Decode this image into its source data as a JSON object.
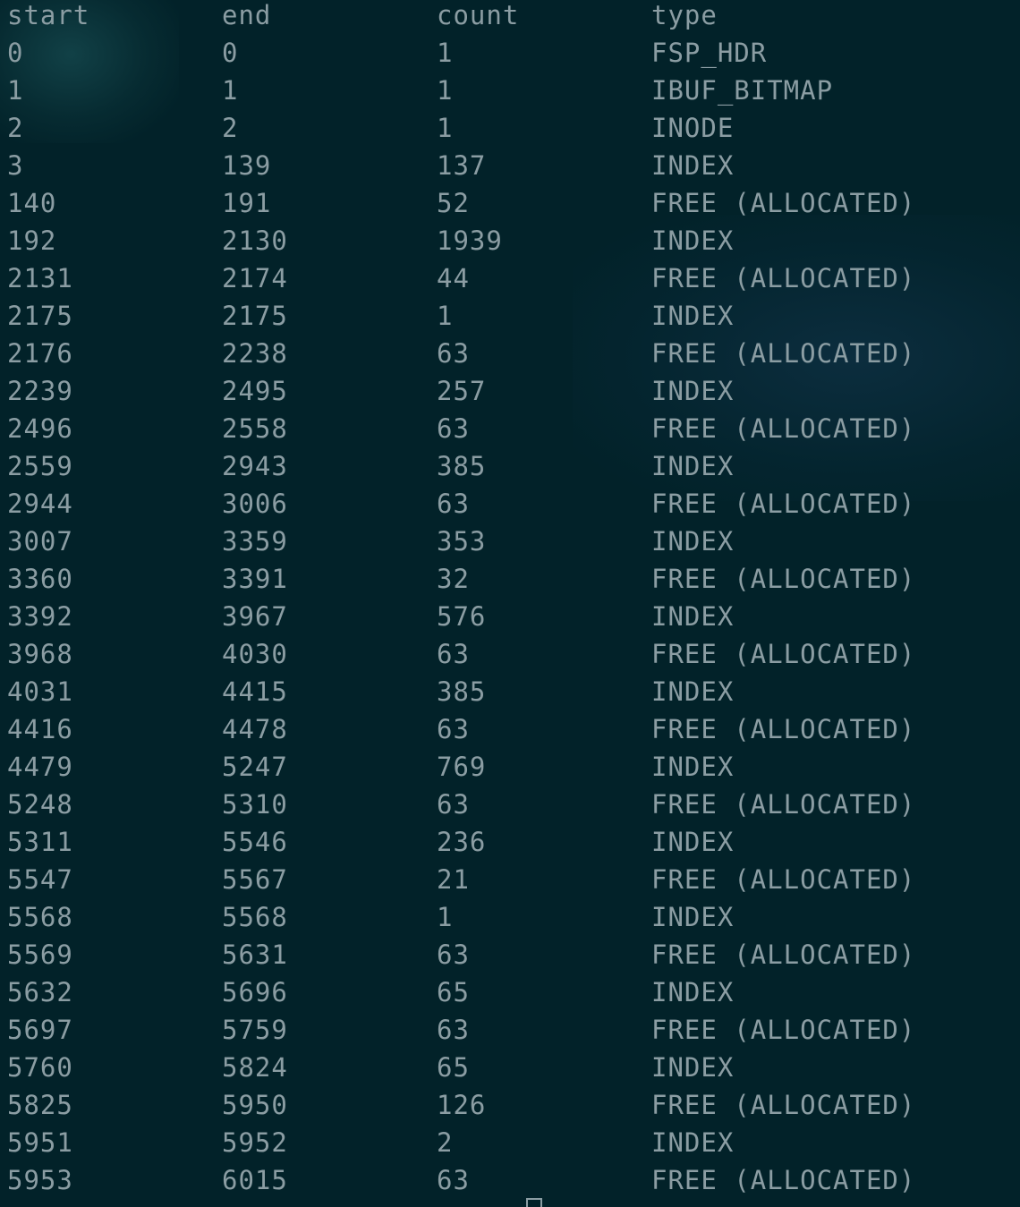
{
  "header": {
    "start": "start",
    "end": "end",
    "count": "count",
    "type": "type"
  },
  "rows": [
    {
      "start": "0",
      "end": "0",
      "count": "1",
      "type": "FSP_HDR"
    },
    {
      "start": "1",
      "end": "1",
      "count": "1",
      "type": "IBUF_BITMAP"
    },
    {
      "start": "2",
      "end": "2",
      "count": "1",
      "type": "INODE"
    },
    {
      "start": "3",
      "end": "139",
      "count": "137",
      "type": "INDEX"
    },
    {
      "start": "140",
      "end": "191",
      "count": "52",
      "type": "FREE (ALLOCATED)"
    },
    {
      "start": "192",
      "end": "2130",
      "count": "1939",
      "type": "INDEX"
    },
    {
      "start": "2131",
      "end": "2174",
      "count": "44",
      "type": "FREE (ALLOCATED)"
    },
    {
      "start": "2175",
      "end": "2175",
      "count": "1",
      "type": "INDEX"
    },
    {
      "start": "2176",
      "end": "2238",
      "count": "63",
      "type": "FREE (ALLOCATED)"
    },
    {
      "start": "2239",
      "end": "2495",
      "count": "257",
      "type": "INDEX"
    },
    {
      "start": "2496",
      "end": "2558",
      "count": "63",
      "type": "FREE (ALLOCATED)"
    },
    {
      "start": "2559",
      "end": "2943",
      "count": "385",
      "type": "INDEX"
    },
    {
      "start": "2944",
      "end": "3006",
      "count": "63",
      "type": "FREE (ALLOCATED)"
    },
    {
      "start": "3007",
      "end": "3359",
      "count": "353",
      "type": "INDEX"
    },
    {
      "start": "3360",
      "end": "3391",
      "count": "32",
      "type": "FREE (ALLOCATED)"
    },
    {
      "start": "3392",
      "end": "3967",
      "count": "576",
      "type": "INDEX"
    },
    {
      "start": "3968",
      "end": "4030",
      "count": "63",
      "type": "FREE (ALLOCATED)"
    },
    {
      "start": "4031",
      "end": "4415",
      "count": "385",
      "type": "INDEX"
    },
    {
      "start": "4416",
      "end": "4478",
      "count": "63",
      "type": "FREE (ALLOCATED)"
    },
    {
      "start": "4479",
      "end": "5247",
      "count": "769",
      "type": "INDEX"
    },
    {
      "start": "5248",
      "end": "5310",
      "count": "63",
      "type": "FREE (ALLOCATED)"
    },
    {
      "start": "5311",
      "end": "5546",
      "count": "236",
      "type": "INDEX"
    },
    {
      "start": "5547",
      "end": "5567",
      "count": "21",
      "type": "FREE (ALLOCATED)"
    },
    {
      "start": "5568",
      "end": "5568",
      "count": "1",
      "type": "INDEX"
    },
    {
      "start": "5569",
      "end": "5631",
      "count": "63",
      "type": "FREE (ALLOCATED)"
    },
    {
      "start": "5632",
      "end": "5696",
      "count": "65",
      "type": "INDEX"
    },
    {
      "start": "5697",
      "end": "5759",
      "count": "63",
      "type": "FREE (ALLOCATED)"
    },
    {
      "start": "5760",
      "end": "5824",
      "count": "65",
      "type": "INDEX"
    },
    {
      "start": "5825",
      "end": "5950",
      "count": "126",
      "type": "FREE (ALLOCATED)"
    },
    {
      "start": "5951",
      "end": "5952",
      "count": "2",
      "type": "INDEX"
    },
    {
      "start": "5953",
      "end": "6015",
      "count": "63",
      "type": "FREE (ALLOCATED)"
    }
  ],
  "colors": {
    "background": "#022229",
    "text": "#8b9da3"
  }
}
